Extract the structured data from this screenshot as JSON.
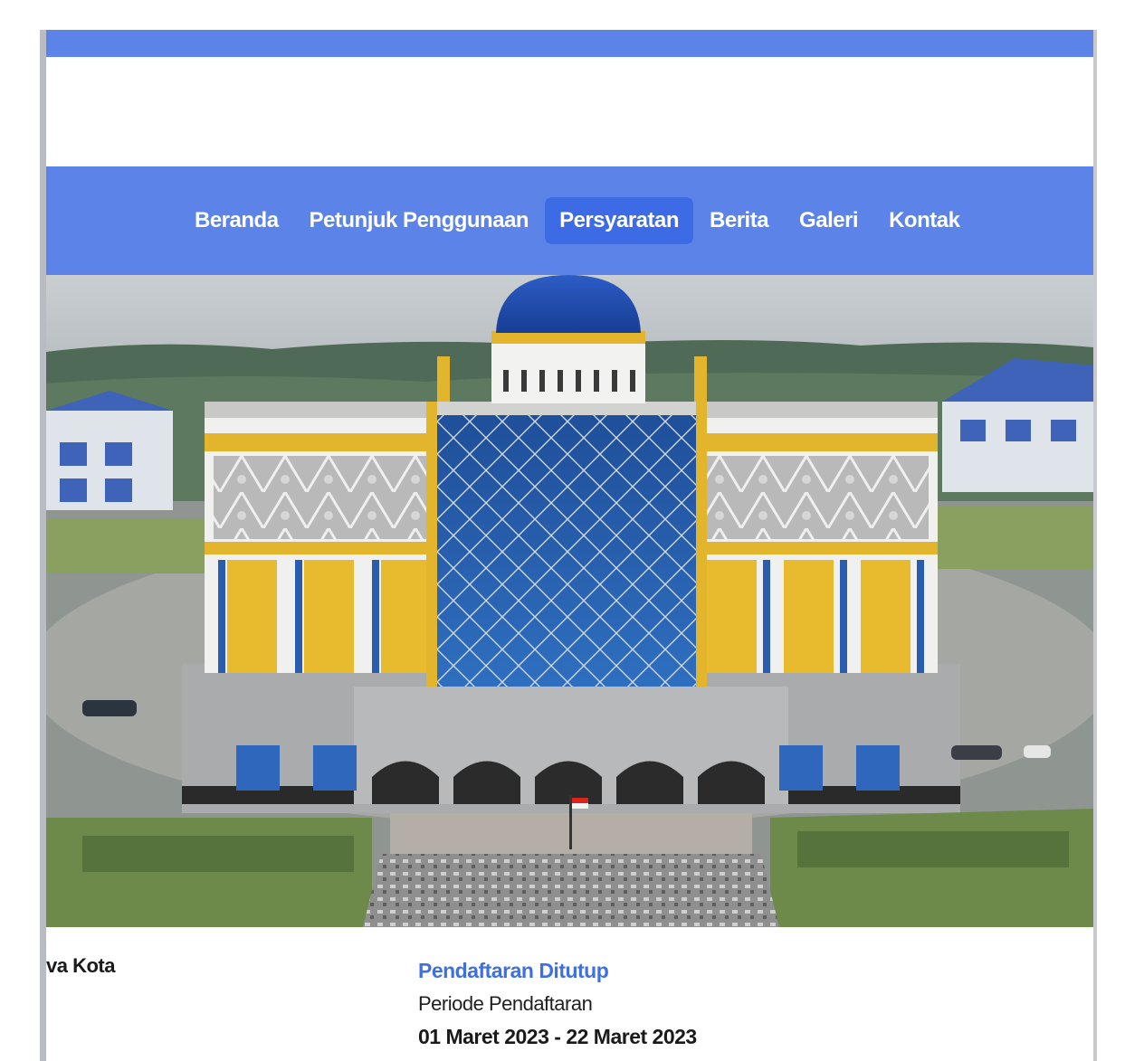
{
  "nav": {
    "items": [
      {
        "label": "Beranda",
        "active": false
      },
      {
        "label": "Petunjuk Penggunaan",
        "active": false
      },
      {
        "label": "Persyaratan",
        "active": true
      },
      {
        "label": "Berita",
        "active": false
      },
      {
        "label": "Galeri",
        "active": false
      },
      {
        "label": "Kontak",
        "active": false
      }
    ]
  },
  "info": {
    "left_text": "va Kota",
    "status": "Pendaftaran Ditutup",
    "period_label": "Periode Pendaftaran",
    "period_dates": "01 Maret 2023 - 22 Maret 2023"
  },
  "colors": {
    "brand_blue": "#5b83e8",
    "active_tab": "#3d6be5",
    "status_blue": "#3f6fe0"
  }
}
